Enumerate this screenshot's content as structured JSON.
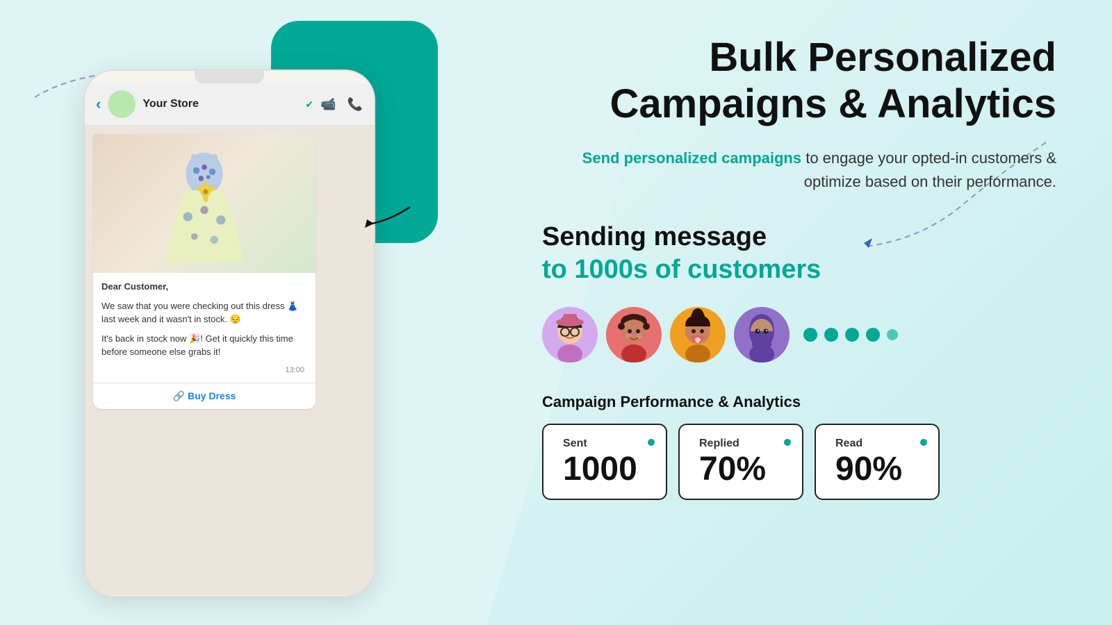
{
  "background": {
    "color": "#dff4f4"
  },
  "phone": {
    "store_name": "Your Store",
    "verified_label": "✔",
    "message": {
      "greeting": "Dear Customer,",
      "body1": "We saw that you were checking out this dress 👗 last week and it wasn't in stock. 😔",
      "body2": "It's back in stock now 🎉! Get it quickly this time before someone else grabs it!",
      "time": "13:00",
      "buy_button_label": "🔗 Buy Dress"
    }
  },
  "right": {
    "main_title": "Bulk Personalized\nCampaigns & Analytics",
    "subtitle_green": "Send personalized campaigns",
    "subtitle_rest": " to engage your opted-in customers & optimize based on their performance.",
    "sending_title": "Sending message",
    "sending_subtitle": "to 1000s of customers",
    "analytics_title": "Campaign Performance & Analytics",
    "cards": [
      {
        "label": "Sent",
        "value": "1000"
      },
      {
        "label": "Replied",
        "value": "70%"
      },
      {
        "label": "Read",
        "value": "90%"
      }
    ],
    "dots": [
      "●",
      "●",
      "●",
      "●",
      "●"
    ]
  },
  "avatars": [
    {
      "id": "avatar-1",
      "color": "#d4aaee",
      "emoji": "🧑"
    },
    {
      "id": "avatar-2",
      "color": "#e87070",
      "emoji": "👩"
    },
    {
      "id": "avatar-3",
      "color": "#f0a020",
      "emoji": "👩"
    },
    {
      "id": "avatar-4",
      "color": "#9070c8",
      "emoji": "🧕"
    }
  ]
}
